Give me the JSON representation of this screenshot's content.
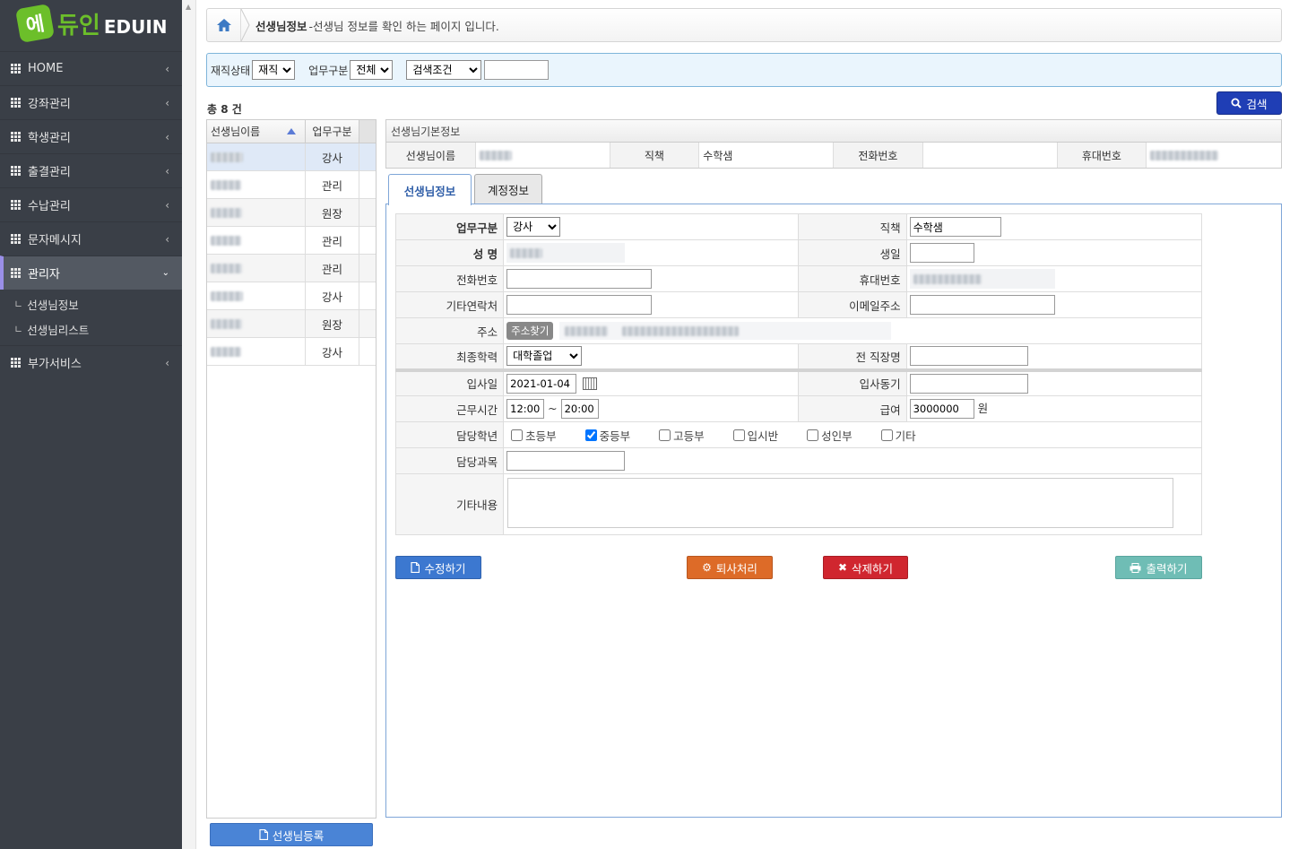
{
  "logo": {
    "badge": "에",
    "korean": "듀인",
    "english": "EDUIN"
  },
  "sidebar": {
    "items": [
      {
        "label": "HOME"
      },
      {
        "label": "강좌관리"
      },
      {
        "label": "학생관리"
      },
      {
        "label": "출결관리"
      },
      {
        "label": "수납관리"
      },
      {
        "label": "문자메시지"
      },
      {
        "label": "관리자"
      },
      {
        "label": "부가서비스"
      }
    ],
    "subitems": [
      {
        "label": "선생님정보"
      },
      {
        "label": "선생님리스트"
      }
    ],
    "active_color": "#9a8fe8"
  },
  "breadcrumb": {
    "title": "선생님정보",
    "desc": "-선생님 정보를 확인 하는 페이지 입니다."
  },
  "filter": {
    "status_label": "재직상태",
    "status_value": "재직",
    "type_label": "업무구분",
    "type_value": "전체",
    "cond_value": "검색조건",
    "search_text": ""
  },
  "total_text": "총 8 건",
  "search_button": "검색",
  "list": {
    "headers": {
      "name": "선생님이름",
      "type": "업무구분"
    },
    "rows": [
      {
        "type": "강사"
      },
      {
        "type": "관리"
      },
      {
        "type": "원장"
      },
      {
        "type": "관리"
      },
      {
        "type": "관리"
      },
      {
        "type": "강사"
      },
      {
        "type": "원장"
      },
      {
        "type": "강사"
      }
    ]
  },
  "register_button": "선생님등록",
  "basic_info": {
    "title": "선생님기본정보",
    "name_label": "선생님이름",
    "position_label": "직책",
    "position_value": "수학샘",
    "phone_label": "전화번호",
    "phone_value": "",
    "mobile_label": "휴대번호"
  },
  "tabs": {
    "info": "선생님정보",
    "account": "계정정보"
  },
  "form": {
    "work_type_label": "업무구분",
    "work_type_value": "강사",
    "position_label": "직책",
    "position_value": "수학샘",
    "name_label": "성  명",
    "birth_label": "생일",
    "birth_value": "",
    "phone_label": "전화번호",
    "phone_value": "",
    "mobile_label": "휴대번호",
    "other_contact_label": "기타연락처",
    "other_contact_value": "",
    "email_label": "이메일주소",
    "email_value": "",
    "address_label": "주소",
    "address_button": "주소찾기",
    "education_label": "최종학력",
    "education_value": "대학졸업",
    "prev_job_label": "전 직장명",
    "prev_job_value": "",
    "join_date_label": "입사일",
    "join_date_value": "2021-01-04",
    "join_motive_label": "입사동기",
    "join_motive_value": "",
    "work_time_label": "근무시간",
    "work_start": "12:00",
    "work_tilde": "~",
    "work_end": "20:00",
    "salary_label": "급여",
    "salary_value": "3000000",
    "salary_unit": "원",
    "grade_label": "담당학년",
    "grades": [
      {
        "label": "초등부",
        "checked": false
      },
      {
        "label": "중등부",
        "checked": true
      },
      {
        "label": "고등부",
        "checked": false
      },
      {
        "label": "입시반",
        "checked": false
      },
      {
        "label": "성인부",
        "checked": false
      },
      {
        "label": "기타",
        "checked": false
      }
    ],
    "subject_label": "담당과목",
    "subject_value": "",
    "memo_label": "기타내용",
    "memo_value": ""
  },
  "actions": {
    "edit": "수정하기",
    "resign": "퇴사처리",
    "delete": "삭제하기",
    "print": "출력하기"
  },
  "colors": {
    "sidebar_bg": "#3a3f47",
    "search_btn": "#1f3eb5",
    "edit_btn": "#3c78d0",
    "resign_btn": "#dd6b28",
    "delete_btn": "#d0262f",
    "print_btn": "#6fbdb5"
  }
}
